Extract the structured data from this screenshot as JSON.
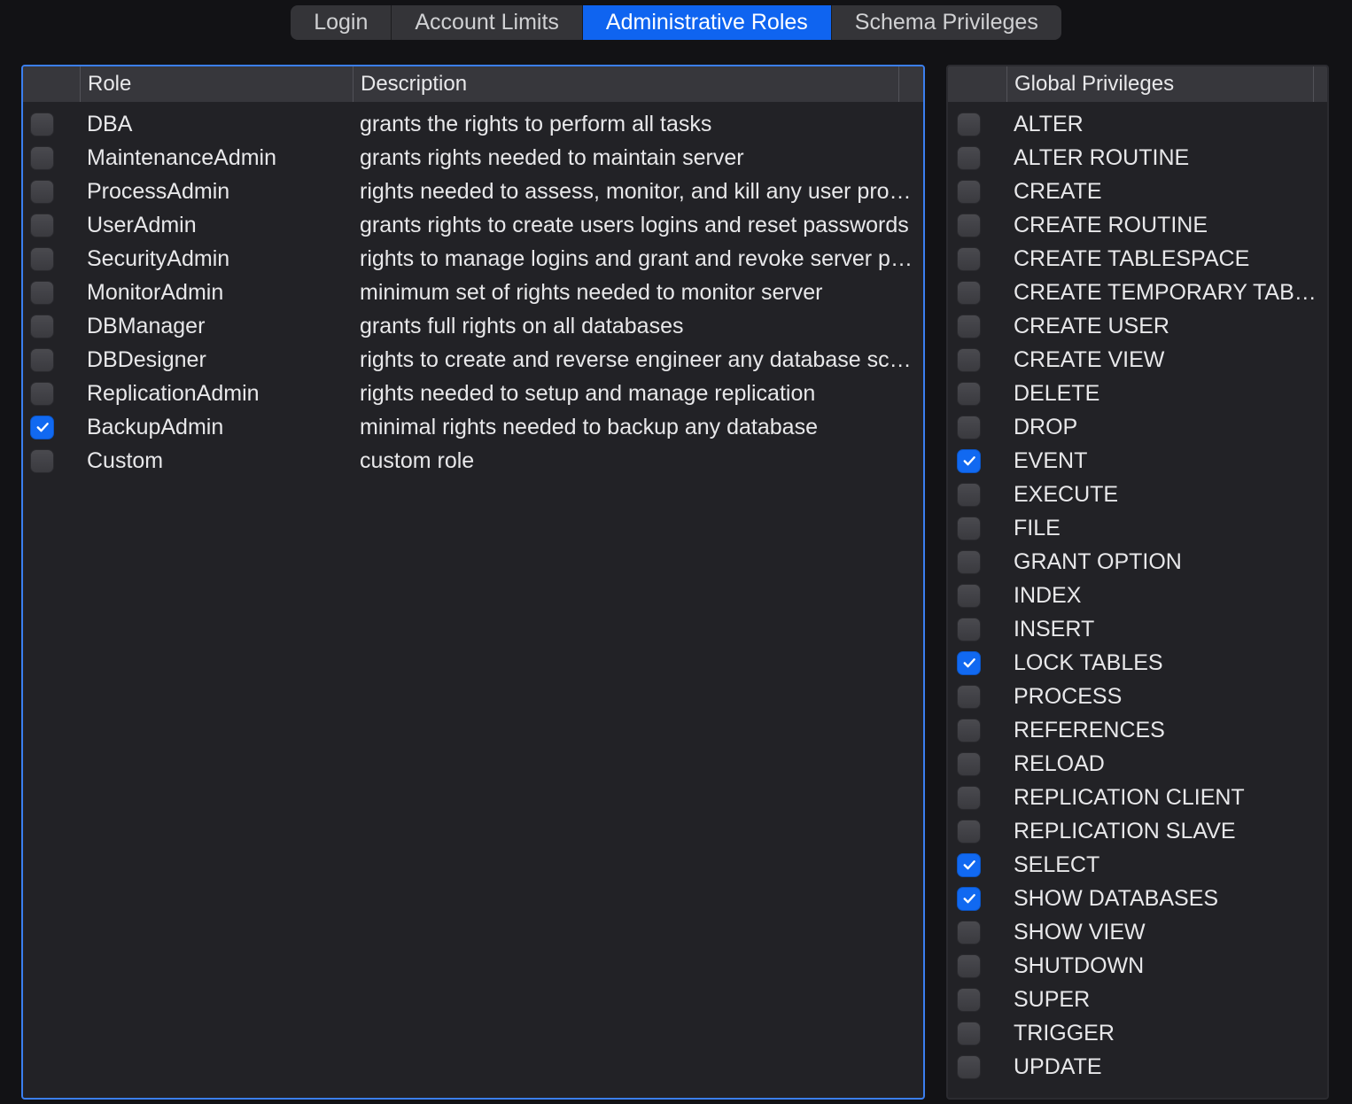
{
  "tabs": [
    {
      "label": "Login",
      "active": false
    },
    {
      "label": "Account Limits",
      "active": false
    },
    {
      "label": "Administrative Roles",
      "active": true
    },
    {
      "label": "Schema Privileges",
      "active": false
    }
  ],
  "roles_panel": {
    "columns": {
      "role": "Role",
      "description": "Description"
    },
    "rows": [
      {
        "checked": false,
        "role": "DBA",
        "description": "grants the rights to perform all tasks"
      },
      {
        "checked": false,
        "role": "MaintenanceAdmin",
        "description": "grants rights needed to maintain server"
      },
      {
        "checked": false,
        "role": "ProcessAdmin",
        "description": "rights needed to assess, monitor, and kill any user process running in server"
      },
      {
        "checked": false,
        "role": "UserAdmin",
        "description": "grants rights to create users logins and reset passwords"
      },
      {
        "checked": false,
        "role": "SecurityAdmin",
        "description": "rights to manage logins and grant and revoke server privileges"
      },
      {
        "checked": false,
        "role": "MonitorAdmin",
        "description": "minimum set of rights needed to monitor server"
      },
      {
        "checked": false,
        "role": "DBManager",
        "description": "grants full rights on all databases"
      },
      {
        "checked": false,
        "role": "DBDesigner",
        "description": "rights to create and reverse engineer any database schema"
      },
      {
        "checked": false,
        "role": "ReplicationAdmin",
        "description": "rights needed to setup and manage replication"
      },
      {
        "checked": true,
        "role": "BackupAdmin",
        "description": "minimal rights needed to backup any database"
      },
      {
        "checked": false,
        "role": "Custom",
        "description": "custom role"
      }
    ]
  },
  "privileges_panel": {
    "columns": {
      "name": "Global Privileges"
    },
    "rows": [
      {
        "checked": false,
        "name": "ALTER"
      },
      {
        "checked": false,
        "name": "ALTER ROUTINE"
      },
      {
        "checked": false,
        "name": "CREATE"
      },
      {
        "checked": false,
        "name": "CREATE ROUTINE"
      },
      {
        "checked": false,
        "name": "CREATE TABLESPACE"
      },
      {
        "checked": false,
        "name": "CREATE TEMPORARY TABLES"
      },
      {
        "checked": false,
        "name": "CREATE USER"
      },
      {
        "checked": false,
        "name": "CREATE VIEW"
      },
      {
        "checked": false,
        "name": "DELETE"
      },
      {
        "checked": false,
        "name": "DROP"
      },
      {
        "checked": true,
        "name": "EVENT"
      },
      {
        "checked": false,
        "name": "EXECUTE"
      },
      {
        "checked": false,
        "name": "FILE"
      },
      {
        "checked": false,
        "name": "GRANT OPTION"
      },
      {
        "checked": false,
        "name": "INDEX"
      },
      {
        "checked": false,
        "name": "INSERT"
      },
      {
        "checked": true,
        "name": "LOCK TABLES"
      },
      {
        "checked": false,
        "name": "PROCESS"
      },
      {
        "checked": false,
        "name": "REFERENCES"
      },
      {
        "checked": false,
        "name": "RELOAD"
      },
      {
        "checked": false,
        "name": "REPLICATION CLIENT"
      },
      {
        "checked": false,
        "name": "REPLICATION SLAVE"
      },
      {
        "checked": true,
        "name": "SELECT"
      },
      {
        "checked": true,
        "name": "SHOW DATABASES"
      },
      {
        "checked": false,
        "name": "SHOW VIEW"
      },
      {
        "checked": false,
        "name": "SHUTDOWN"
      },
      {
        "checked": false,
        "name": "SUPER"
      },
      {
        "checked": false,
        "name": "TRIGGER"
      },
      {
        "checked": false,
        "name": "UPDATE"
      }
    ]
  }
}
